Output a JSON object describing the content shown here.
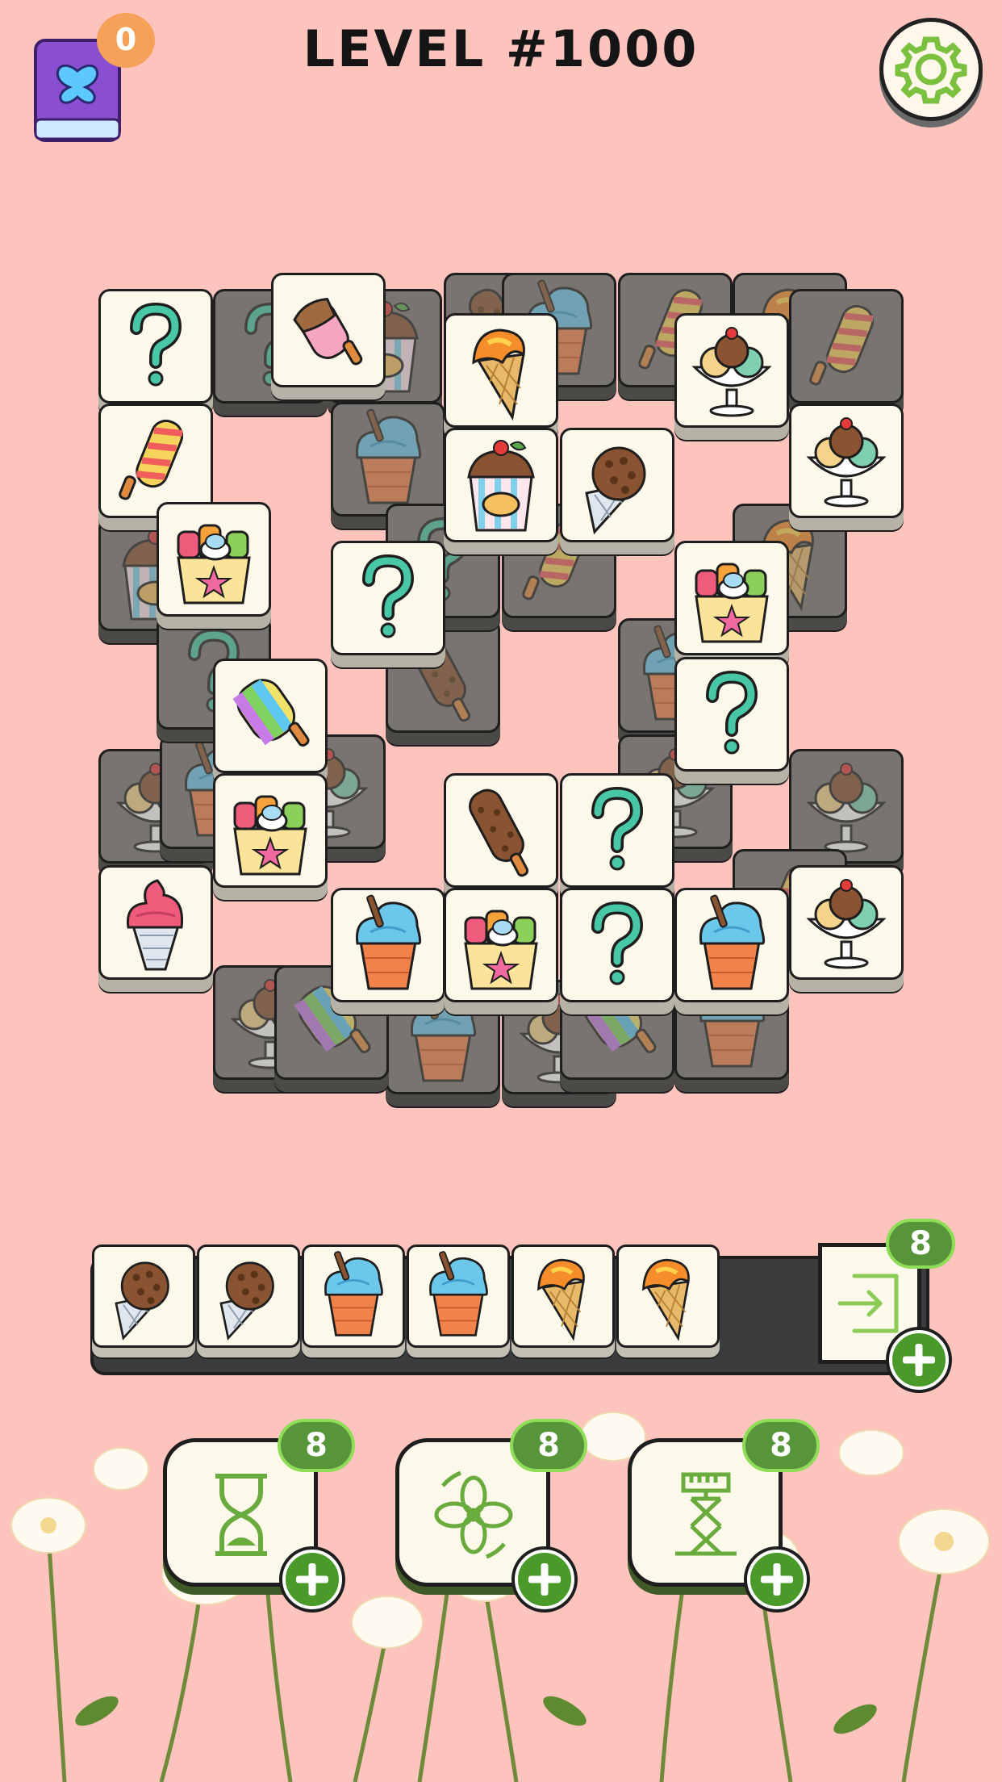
{
  "header": {
    "title": "LEVEL #1000",
    "collection_badge": "0"
  },
  "colors": {
    "background": "#fdc4bd",
    "tile_face": "#fcf8ea",
    "covered_tile": "#787570",
    "accent_green": "#57943a",
    "badge_orange": "#f5a15a"
  },
  "board": {
    "tiles": [
      {
        "kind": "question",
        "state": "covered"
      },
      {
        "kind": "ice-cream-tub",
        "state": "covered"
      },
      {
        "kind": "chocolate-bar",
        "state": "covered"
      },
      {
        "kind": "swirl-cup",
        "state": "covered"
      },
      {
        "kind": "twist-pop",
        "state": "covered"
      },
      {
        "kind": "waffle-cone",
        "state": "covered"
      },
      {
        "kind": "twist-pop",
        "state": "covered"
      },
      {
        "kind": "swirl-cup",
        "state": "covered"
      },
      {
        "kind": "ice-cream-tub",
        "state": "covered"
      },
      {
        "kind": "sundae-bowl",
        "state": "covered"
      },
      {
        "kind": "swirl-cup",
        "state": "covered"
      },
      {
        "kind": "waffle-cone",
        "state": "covered"
      },
      {
        "kind": "question",
        "state": "covered"
      },
      {
        "kind": "chocolate-bar",
        "state": "covered"
      },
      {
        "kind": "swirl-cup",
        "state": "covered"
      },
      {
        "kind": "sundae-bowl",
        "state": "covered"
      },
      {
        "kind": "sundae-bowl",
        "state": "covered"
      },
      {
        "kind": "twist-pop",
        "state": "covered"
      },
      {
        "kind": "swirl-cup",
        "state": "covered"
      },
      {
        "kind": "swirl-cup",
        "state": "covered"
      },
      {
        "kind": "popsicle",
        "state": "covered"
      },
      {
        "kind": "chocolate-bar",
        "state": "covered"
      },
      {
        "kind": "sundae-bowl",
        "state": "covered"
      },
      {
        "kind": "swirl-cup",
        "state": "covered"
      },
      {
        "kind": "sundae-bowl",
        "state": "covered"
      },
      {
        "kind": "rainbow-pop",
        "state": "covered"
      },
      {
        "kind": "swirl-cup",
        "state": "covered"
      },
      {
        "kind": "sundae-bowl",
        "state": "covered"
      },
      {
        "kind": "question",
        "state": "covered"
      },
      {
        "kind": "twist-pop",
        "state": "covered"
      },
      {
        "kind": "rainbow-pop",
        "state": "covered"
      },
      {
        "kind": "question",
        "state": "open"
      },
      {
        "kind": "popsicle",
        "state": "open"
      },
      {
        "kind": "twist-pop",
        "state": "open"
      },
      {
        "kind": "waffle-cone",
        "state": "open"
      },
      {
        "kind": "sundae-bowl",
        "state": "open"
      },
      {
        "kind": "ice-cream-tub",
        "state": "open"
      },
      {
        "kind": "choco-cone",
        "state": "open"
      },
      {
        "kind": "sundae-bowl",
        "state": "open"
      },
      {
        "kind": "roll-cup",
        "state": "open"
      },
      {
        "kind": "question",
        "state": "open"
      },
      {
        "kind": "roll-cup",
        "state": "open"
      },
      {
        "kind": "rainbow-pop",
        "state": "open"
      },
      {
        "kind": "question",
        "state": "open"
      },
      {
        "kind": "roll-cup",
        "state": "open"
      },
      {
        "kind": "chocolate-bar",
        "state": "open"
      },
      {
        "kind": "question",
        "state": "open"
      },
      {
        "kind": "soft-serve-cone",
        "state": "open"
      },
      {
        "kind": "swirl-cup",
        "state": "open"
      },
      {
        "kind": "roll-cup",
        "state": "open"
      },
      {
        "kind": "question",
        "state": "open"
      },
      {
        "kind": "swirl-cup",
        "state": "open"
      },
      {
        "kind": "sundae-bowl",
        "state": "open"
      }
    ]
  },
  "tray": {
    "slots": [
      {
        "kind": "choco-cone"
      },
      {
        "kind": "choco-cone"
      },
      {
        "kind": "swirl-cup"
      },
      {
        "kind": "swirl-cup"
      },
      {
        "kind": "waffle-cone"
      },
      {
        "kind": "waffle-cone"
      }
    ],
    "undo": {
      "icon": "move-out-icon",
      "count": "8"
    }
  },
  "boosters": [
    {
      "name": "hourglass-icon",
      "count": "8"
    },
    {
      "name": "shuffle-icon",
      "count": "8"
    },
    {
      "name": "magnet-icon",
      "count": "8"
    }
  ]
}
